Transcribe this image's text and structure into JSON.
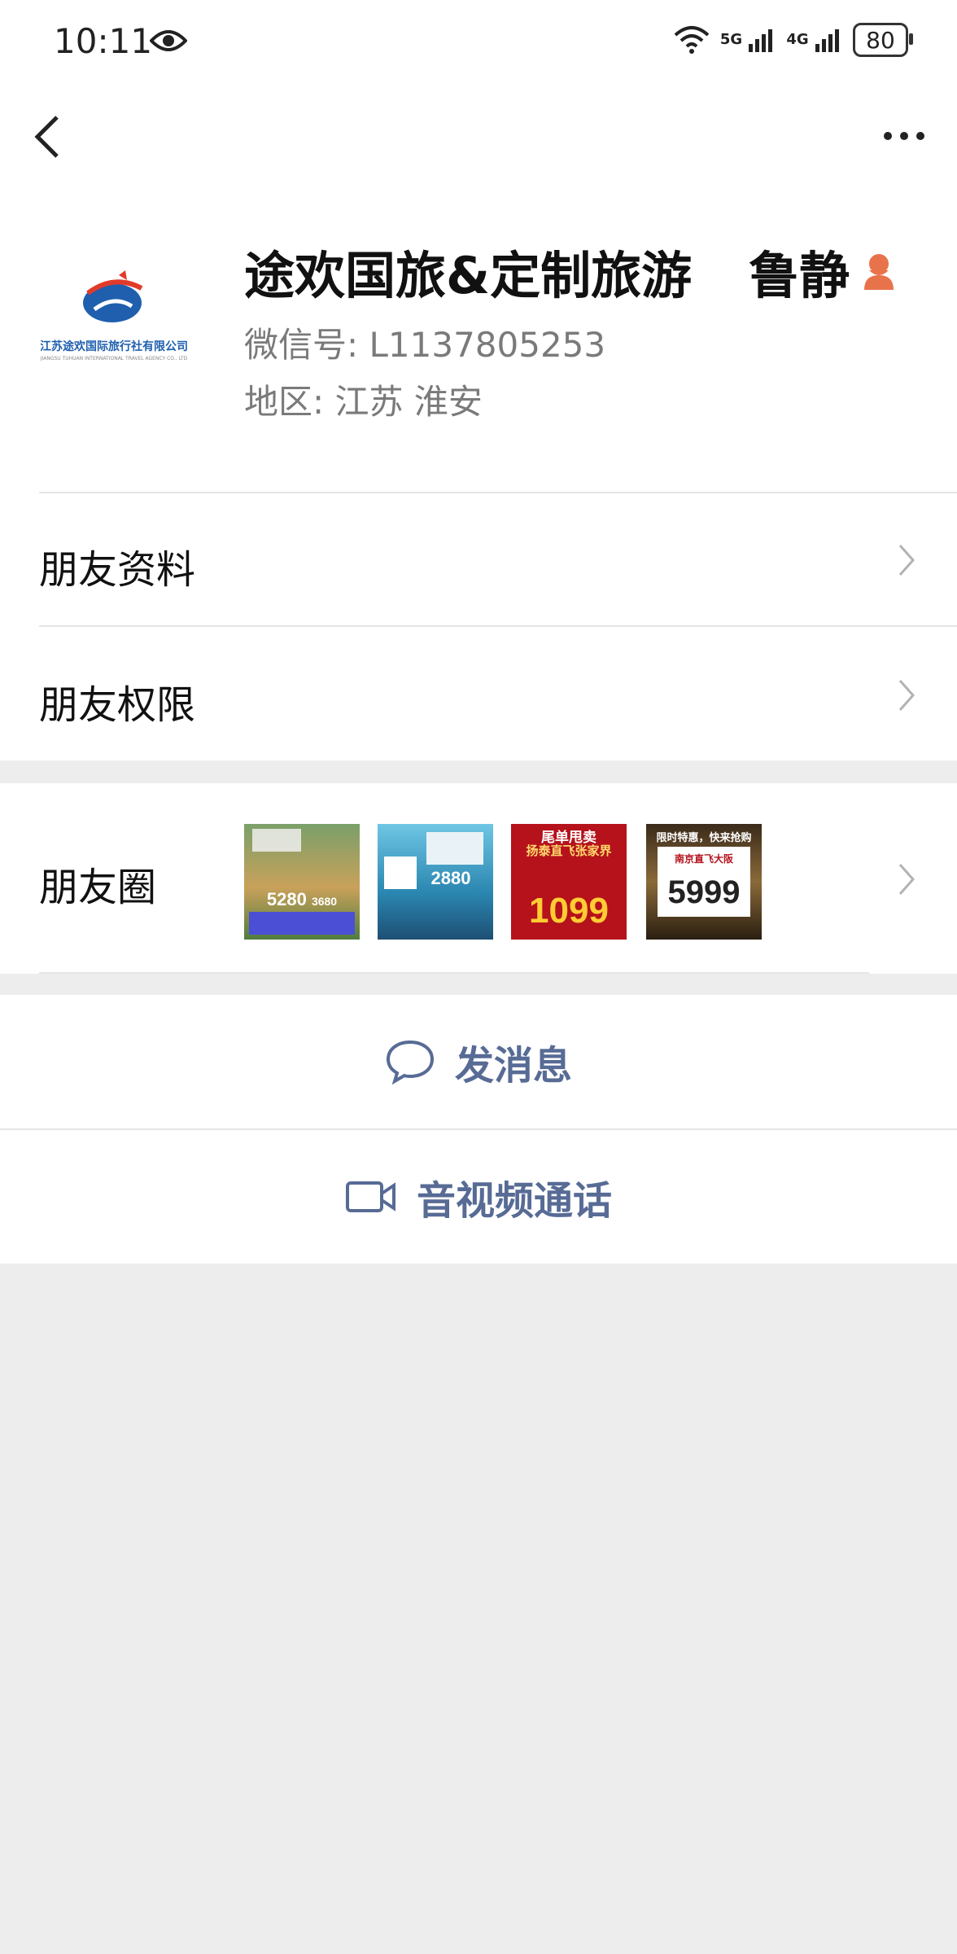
{
  "status_bar": {
    "time": "10:11",
    "network_1": "5G",
    "network_2": "4G",
    "battery": "80"
  },
  "profile": {
    "display_name": "途欢国旅&定制旅游",
    "remark_name": "鲁静",
    "wechat_id": "微信号:  L1137805253",
    "region": "地区:  江苏  淮安",
    "avatar_caption": "江苏途欢国际旅行社有限公司"
  },
  "menu": {
    "friend_info": "朋友资料",
    "friend_permissions": "朋友权限",
    "moments": "朋友圈"
  },
  "moments_thumbs": [
    {
      "price": "5280",
      "price2": "3680"
    },
    {
      "price": "2880"
    },
    {
      "headline1": "尾单甩卖",
      "headline2": "扬泰直飞张家界",
      "price": "1099"
    },
    {
      "headline1": "限时特惠，快来抢购",
      "sub": "南京直飞大阪",
      "price": "5999"
    }
  ],
  "actions": {
    "send_message": "发消息",
    "video_call": "音视频通话"
  },
  "colors": {
    "link": "#576b95",
    "accent_orange": "#e8734a",
    "background": "#ededed"
  }
}
